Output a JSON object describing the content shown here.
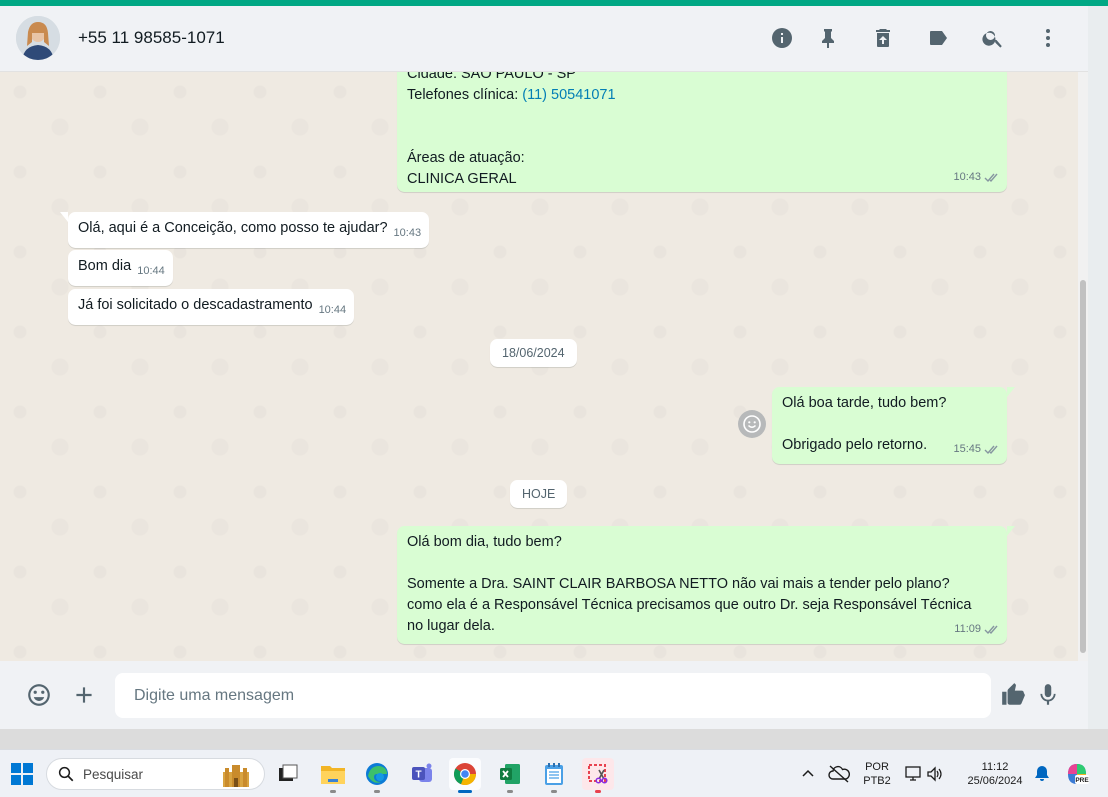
{
  "header": {
    "contact_name": "+55 11 98585-1071",
    "icons": [
      "info-icon",
      "pin-icon",
      "delete-icon",
      "label-icon",
      "search-icon",
      "menu-icon"
    ]
  },
  "messages": {
    "m1": {
      "lines": [
        "Cidade: SÃO PAULO - SP",
        "Telefones clínica: (11) 50541071",
        "",
        "",
        "Áreas de atuação:",
        "CLINICA GERAL"
      ],
      "line1_prefix": "Telefones clínica: ",
      "line1_phone": "(11) 50541071",
      "time": "10:43"
    },
    "m2": {
      "text": "Olá, aqui é a Conceição, como posso te ajudar?",
      "time": "10:43"
    },
    "m3": {
      "text": "Bom dia",
      "time": "10:44"
    },
    "m4": {
      "text": "Já foi solicitado o descadastramento",
      "time": "10:44"
    },
    "date1": "18/06/2024",
    "m5": {
      "line1": "Olá boa tarde, tudo bem?",
      "line2": "Obrigado pelo retorno.",
      "time": "15:45"
    },
    "date2": "HOJE",
    "m6": {
      "line1": "Olá bom dia, tudo bem?",
      "line2": "Somente a Dra. SAINT CLAIR BARBOSA NETTO não vai mais a tender pelo plano?",
      "line3": "como ela é a Responsável Técnica precisamos que outro Dr. seja Responsável Técnica",
      "line4": "no lugar dela.",
      "time": "11:09"
    }
  },
  "composer": {
    "placeholder": "Digite uma mensagem"
  },
  "taskbar": {
    "search_label": "Pesquisar",
    "lang_top": "POR",
    "lang_bottom": "PTB2",
    "time": "11:12",
    "date": "25/06/2024",
    "copilot_badge": "PRE"
  },
  "colors": {
    "accent": "#00a884",
    "outgoing": "#d9fdd3",
    "incoming": "#ffffff",
    "link": "#027eb5"
  }
}
